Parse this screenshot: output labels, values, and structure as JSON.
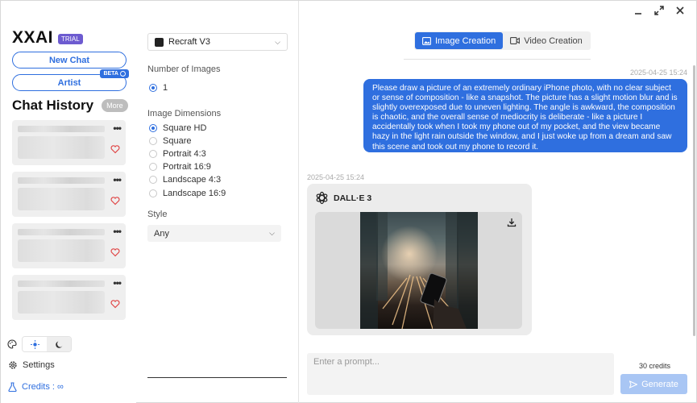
{
  "window": {
    "controls": [
      "minimize-icon",
      "maximize-icon",
      "close-icon"
    ]
  },
  "sidebar": {
    "brand": "XXAI",
    "trial_badge": "TRIAL",
    "new_chat": "New Chat",
    "artist": "Artist",
    "artist_badge": "BETA",
    "chat_history_title": "Chat History",
    "more": "More",
    "settings": "Settings",
    "credits": "Credits : ∞"
  },
  "panel": {
    "model": "Recraft V3",
    "num_images_label": "Number of Images",
    "num_images_options": [
      "1"
    ],
    "num_images_selected": "1",
    "dimensions_label": "Image Dimensions",
    "dimensions": [
      "Square HD",
      "Square",
      "Portrait 4:3",
      "Portrait 16:9",
      "Landscape 4:3",
      "Landscape 16:9"
    ],
    "dimensions_selected": "Square HD",
    "style_label": "Style",
    "style_value": "Any"
  },
  "main": {
    "tabs": [
      {
        "label": "Image Creation",
        "active": true
      },
      {
        "label": "Video Creation",
        "active": false
      }
    ],
    "user_time": "2025-04-25 15:24",
    "user_message": "Please draw a picture of an extremely ordinary iPhone photo, with no clear subject or sense of composition - like a snapshot. The picture has a slight motion blur and is slightly overexposed due to uneven lighting. The angle is awkward, the composition is chaotic, and the overall sense of mediocrity is deliberate - like a picture I accidentally took when I took my phone out of my pocket, and the view became hazy in the light rain outside the window, and I just woke up from a dream and saw this scene and took out my phone to record it.",
    "bot_time": "2025-04-25 15:24",
    "bot_name": "DALL·E 3",
    "prompt_placeholder": "Enter a prompt...",
    "credits": "30 credits",
    "generate": "Generate"
  },
  "colors": {
    "accent": "#2f6fdf",
    "trial": "#6d5bd0",
    "generate_disabled": "#a9c6f4"
  }
}
